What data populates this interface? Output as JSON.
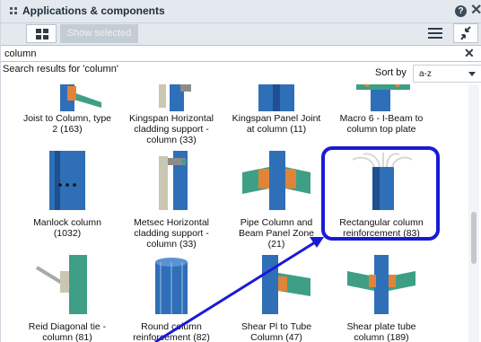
{
  "window": {
    "title": "Applications & components",
    "help_glyph": "?",
    "close_glyph": "✕"
  },
  "toolbar": {
    "show_selected_label": "Show selected"
  },
  "search": {
    "value": "column",
    "clear_glyph": "✕",
    "results_label": "Search results for 'column'"
  },
  "sort": {
    "label": "Sort by",
    "selected": "a-z"
  },
  "gallery": {
    "tiles": [
      {
        "name": "Joist to Column, type 2 (163)",
        "caption_lines": [
          "Joist to Column, type",
          "2 (163)"
        ]
      },
      {
        "name": "Kingspan Horizontal cladding support - column (33)",
        "caption_lines": [
          "Kingspan Horizontal",
          "cladding support -",
          "column (33)"
        ]
      },
      {
        "name": "Kingspan Panel Joint at column (11)",
        "caption_lines": [
          "Kingspan Panel Joint",
          "at column (11)"
        ]
      },
      {
        "name": "Macro 6 - I-Beam to column top plate",
        "caption_lines": [
          "Macro 6 - I-Beam to",
          "column top plate"
        ]
      },
      {
        "name": "Manlock column (1032)",
        "caption_lines": [
          "Manlock column",
          "(1032)"
        ]
      },
      {
        "name": "Metsec Horizontal cladding support - column (33)",
        "caption_lines": [
          "Metsec Horizontal",
          "cladding support -",
          "column (33)"
        ]
      },
      {
        "name": "Pipe Column and Beam Panel Zone (21)",
        "caption_lines": [
          "Pipe Column and",
          "Beam Panel Zone",
          "(21)"
        ]
      },
      {
        "name": "Rectangular column reinforcement (83)",
        "caption_lines": [
          "Rectangular column",
          "reinforcement (83)"
        ]
      },
      {
        "name": "Reid Diagonal tie - column (81)",
        "caption_lines": [
          "Reid Diagonal tie -",
          "column (81)"
        ]
      },
      {
        "name": "Round column reinforcement (82)",
        "caption_lines": [
          "Round column",
          "reinforcement (82)"
        ]
      },
      {
        "name": "Shear Pl to Tube Column (47)",
        "caption_lines": [
          "Shear Pl to Tube",
          "Column (47)"
        ]
      },
      {
        "name": "Shear plate tube column (189)",
        "caption_lines": [
          "Shear plate tube",
          "column (189)"
        ]
      }
    ]
  },
  "colors": {
    "highlight": "#1a1ad6",
    "steel_blue": "#2f6fb8",
    "steel_green": "#3e9f86"
  },
  "icons": [
    "grid-view-icon",
    "hamburger-menu-icon",
    "collapse-icon",
    "help-icon",
    "close-icon",
    "clear-search-icon",
    "dropdown-arrow-icon"
  ]
}
